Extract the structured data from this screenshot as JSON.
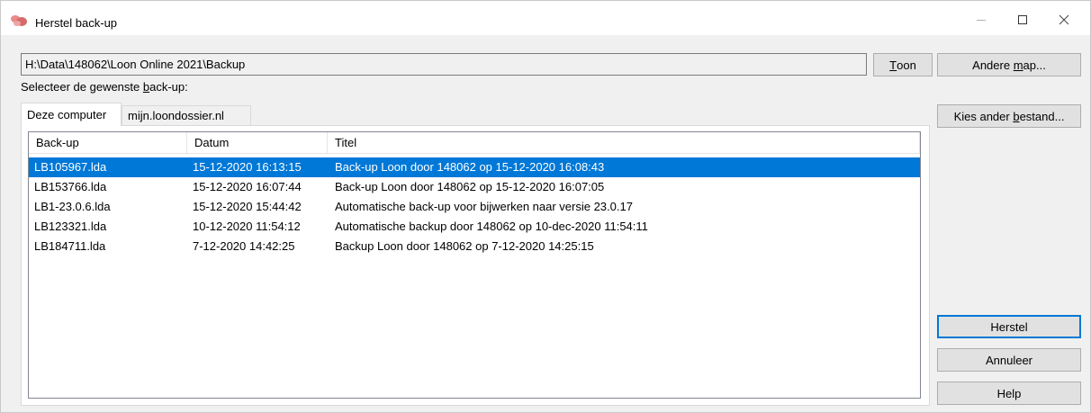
{
  "window": {
    "title": "Herstel back-up",
    "icon": "app-icon"
  },
  "path": {
    "value": "H:\\Data\\148062\\Loon Online 2021\\Backup"
  },
  "buttons": {
    "toon_prefix": "",
    "toon_underline": "T",
    "toon_suffix": "oon",
    "andere_prefix": "Andere ",
    "andere_underline": "m",
    "andere_suffix": "ap...",
    "kies_prefix": "Kies ander ",
    "kies_underline": "b",
    "kies_suffix": "estand...",
    "herstel": "Herstel",
    "annuleer": "Annuleer",
    "help": "Help"
  },
  "select_label": {
    "prefix": "Selecteer de gewenste ",
    "underline": "b",
    "suffix": "ack-up:"
  },
  "tabs": [
    {
      "label": "Deze computer",
      "active": true
    },
    {
      "label": "mijn.loondossier.nl",
      "active": false
    }
  ],
  "list": {
    "columns": [
      "Back-up",
      "Datum",
      "Titel"
    ],
    "rows": [
      {
        "backup": "LB105967.lda",
        "datum": "15-12-2020 16:13:15",
        "titel": "Back-up Loon door 148062 op 15-12-2020 16:08:43",
        "selected": true
      },
      {
        "backup": "LB153766.lda",
        "datum": "15-12-2020 16:07:44",
        "titel": "Back-up Loon door 148062 op 15-12-2020 16:07:05",
        "selected": false
      },
      {
        "backup": "LB1-23.0.6.lda",
        "datum": "15-12-2020 15:44:42",
        "titel": "Automatische back-up voor bijwerken naar versie 23.0.17",
        "selected": false
      },
      {
        "backup": "LB123321.lda",
        "datum": "10-12-2020 11:54:12",
        "titel": "Automatische backup door 148062 op 10-dec-2020 11:54:11",
        "selected": false
      },
      {
        "backup": "LB184711.lda",
        "datum": "7-12-2020 14:42:25",
        "titel": "Backup Loon door 148062 op 7-12-2020 14:25:15",
        "selected": false
      }
    ]
  },
  "colors": {
    "selection": "#0078d7",
    "default_button_border": "#0078d7"
  }
}
